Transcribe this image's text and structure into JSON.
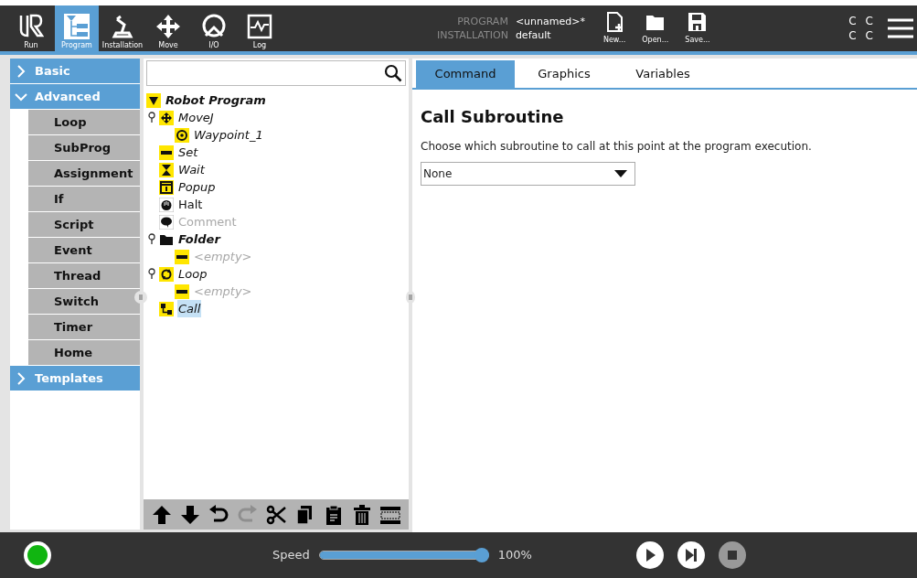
{
  "nav": [
    {
      "label": "Run",
      "kind": "logo",
      "selected": false
    },
    {
      "label": "Program",
      "kind": "program",
      "selected": true
    },
    {
      "label": "Installation",
      "kind": "installation",
      "selected": false
    },
    {
      "label": "Move",
      "kind": "move",
      "selected": false
    },
    {
      "label": "I/O",
      "kind": "io",
      "selected": false
    },
    {
      "label": "Log",
      "kind": "log",
      "selected": false
    }
  ],
  "info": [
    {
      "label": "PROGRAM",
      "value": "<unnamed>*"
    },
    {
      "label": "INSTALLATION",
      "value": "default"
    }
  ],
  "file_buttons": [
    {
      "label": "New...",
      "kind": "new"
    },
    {
      "label": "Open...",
      "kind": "open"
    },
    {
      "label": "Save...",
      "kind": "save"
    }
  ],
  "status_letters": [
    "C",
    "C",
    "C",
    "C"
  ],
  "sidebar": [
    {
      "label": "Basic",
      "expanded": false
    },
    {
      "label": "Advanced",
      "expanded": true,
      "items": [
        "Loop",
        "SubProg",
        "Assignment",
        "If",
        "Script",
        "Event",
        "Thread",
        "Switch",
        "Timer",
        "Home"
      ]
    },
    {
      "label": "Templates",
      "expanded": false
    }
  ],
  "tree": {
    "label": "Robot Program",
    "kind": "root",
    "italic": true,
    "bold": true,
    "disabled": false,
    "selected": false,
    "children": [
      {
        "label": "MoveJ",
        "kind": "move",
        "italic": true,
        "bold": false,
        "disabled": false,
        "selected": false,
        "children": [
          {
            "label": "Waypoint_1",
            "kind": "waypoint",
            "italic": true,
            "bold": false,
            "disabled": false,
            "selected": false
          }
        ]
      },
      {
        "label": "Set",
        "kind": "set",
        "italic": true,
        "bold": false,
        "disabled": false,
        "selected": false
      },
      {
        "label": "Wait",
        "kind": "wait",
        "italic": true,
        "bold": false,
        "disabled": false,
        "selected": false
      },
      {
        "label": "Popup",
        "kind": "popup",
        "italic": true,
        "bold": false,
        "disabled": false,
        "selected": false
      },
      {
        "label": "Halt",
        "kind": "halt",
        "italic": false,
        "bold": false,
        "disabled": false,
        "selected": false
      },
      {
        "label": "Comment",
        "kind": "comment",
        "italic": false,
        "bold": false,
        "disabled": true,
        "selected": false
      },
      {
        "label": "Folder",
        "kind": "folder",
        "italic": true,
        "bold": true,
        "disabled": false,
        "selected": false,
        "children": [
          {
            "label": "<empty>",
            "kind": "set",
            "italic": true,
            "bold": false,
            "disabled": true,
            "selected": false
          }
        ]
      },
      {
        "label": "Loop",
        "kind": "loop",
        "italic": true,
        "bold": false,
        "disabled": false,
        "selected": false,
        "children": [
          {
            "label": "<empty>",
            "kind": "set",
            "italic": true,
            "bold": false,
            "disabled": true,
            "selected": false
          }
        ]
      },
      {
        "label": "Call",
        "kind": "call",
        "italic": true,
        "bold": false,
        "disabled": false,
        "selected": true
      }
    ]
  },
  "toolbar": [
    {
      "kind": "up",
      "disabled": false
    },
    {
      "kind": "down",
      "disabled": false
    },
    {
      "kind": "undo",
      "disabled": false
    },
    {
      "kind": "redo",
      "disabled": true
    },
    {
      "kind": "cut",
      "disabled": false
    },
    {
      "kind": "copy",
      "disabled": false
    },
    {
      "kind": "paste",
      "disabled": false
    },
    {
      "kind": "delete",
      "disabled": false
    },
    {
      "kind": "suppress",
      "disabled": false
    }
  ],
  "tabs": [
    {
      "label": "Command",
      "selected": true
    },
    {
      "label": "Graphics",
      "selected": false
    },
    {
      "label": "Variables",
      "selected": false
    }
  ],
  "command": {
    "title": "Call Subroutine",
    "description": "Choose which subroutine to call at this point at the program execution.",
    "dropdown": {
      "value": "None"
    }
  },
  "footer": {
    "robot_on": true,
    "speed_label": "Speed",
    "speed": {
      "level": 1.0
    },
    "speed_reading": "100%",
    "controls": [
      {
        "kind": "play",
        "disabled": false
      },
      {
        "kind": "step",
        "disabled": false
      },
      {
        "kind": "stop",
        "disabled": true
      }
    ]
  }
}
